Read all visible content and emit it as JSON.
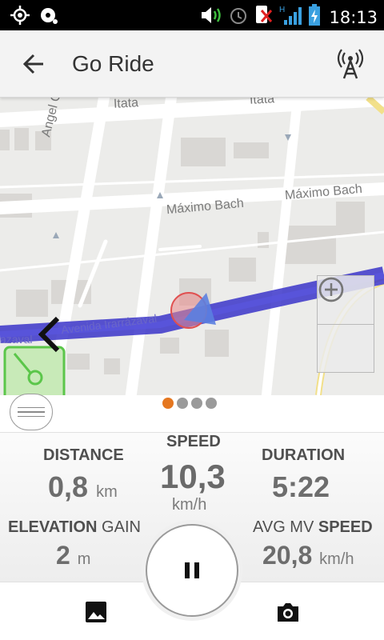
{
  "status_bar": {
    "time": "18:13",
    "icons": [
      "gps-icon",
      "podcast-icon",
      "volume-icon",
      "alarm-icon",
      "sim-blocked-icon",
      "signal-icon",
      "battery-charging-icon"
    ],
    "network_type": "H"
  },
  "app_bar": {
    "title": "Go Ride",
    "back_icon": "arrow-left-icon",
    "action_icon": "gps-antenna-icon"
  },
  "map": {
    "streets": {
      "itata_1": "Itata",
      "itata_2": "Itata",
      "angel_cruchaga": "Angel Cruch",
      "maximo_bach_1": "Máximo Bach",
      "maximo_bach_2": "Máximo Bach",
      "avenida": "Avenida Irarrázaval",
      "avenida_short": "azaval"
    },
    "route_color": "#3b35c9",
    "zoom_in_icon": "plus-circle-icon",
    "zoom_out_icon": "minus-circle-icon"
  },
  "stats": {
    "page_count": 4,
    "active_page": 0,
    "accent_color": "#e57720",
    "distance": {
      "label": "DISTANCE",
      "value": "0,8",
      "unit": "km"
    },
    "speed": {
      "label": "SPEED",
      "value": "10,3",
      "unit": "km/h"
    },
    "duration": {
      "label": "DURATION",
      "value": "5:22"
    },
    "elevation": {
      "label_bold": "ELEVATION",
      "label_thin": "GAIN",
      "value": "2",
      "unit": "m"
    },
    "avg_speed": {
      "label_thin": "AVG MV",
      "label_bold": "SPEED",
      "value": "20,8",
      "unit": "km/h"
    }
  },
  "bottom_bar": {
    "gallery_icon": "image-icon",
    "pause_icon": "pause-icon",
    "camera_icon": "camera-icon"
  }
}
